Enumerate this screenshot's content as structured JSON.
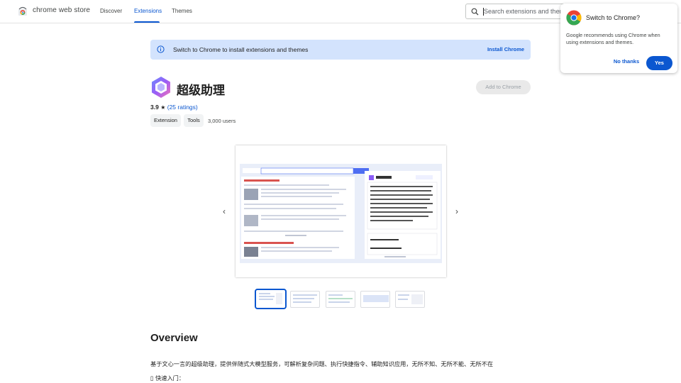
{
  "header": {
    "brand": "chrome web store",
    "nav": [
      "Discover",
      "Extensions",
      "Themes"
    ],
    "search_placeholder": "Search extensions and themes"
  },
  "popup": {
    "title": "Switch to Chrome?",
    "body": "Google recommends using Chrome when using extensions and themes.",
    "no_label": "No thanks",
    "yes_label": "Yes"
  },
  "banner": {
    "text": "Switch to Chrome to install extensions and themes",
    "button": "Install Chrome"
  },
  "extension": {
    "name": "超级助理",
    "add_label": "Add to Chrome",
    "rating": "3.9",
    "star": "★",
    "ratings_count": "(25 ratings)",
    "chips": [
      "Extension",
      "Tools"
    ],
    "users": "3,000 users"
  },
  "carousel": {
    "prev_icon": "‹",
    "next_icon": "›",
    "slide_count": 5,
    "selected_index": 0
  },
  "overview": {
    "title": "Overview",
    "description": "基于文心一言的超级助理，提供伴随式大模型服务，可解析复杂问题、执行快捷指令、辅助知识应用，无所不知、无所不能、无所不在",
    "quick_start": "▯ 快速入门："
  },
  "colors": {
    "accent": "#0b57d0",
    "banner_bg": "#d3e3fd",
    "disabled_btn": "#e9e9e9"
  }
}
